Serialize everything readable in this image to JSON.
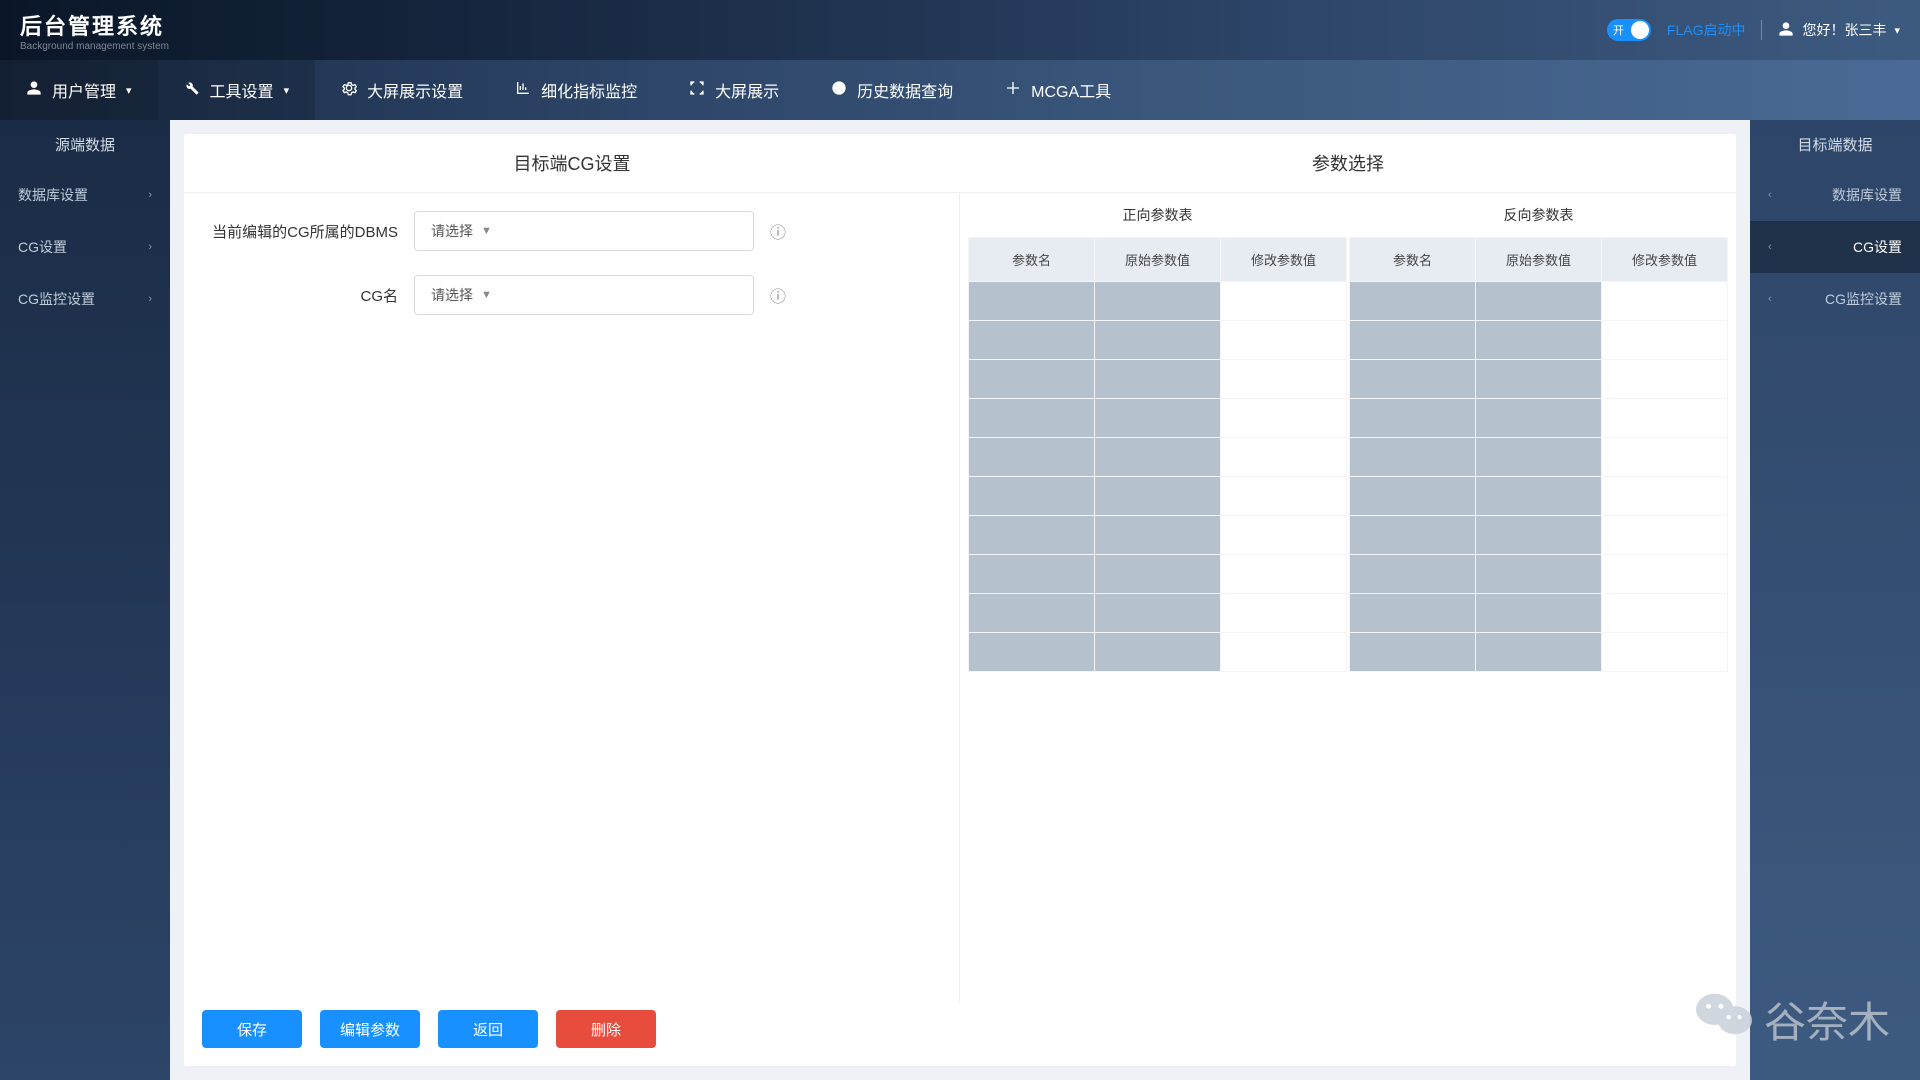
{
  "header": {
    "title": "后台管理系统",
    "subtitle": "Background management system",
    "toggle_on": "开",
    "flag_label": "FLAG启动中",
    "user_greeting": "您好！张三丰"
  },
  "topnav": [
    {
      "label": "用户管理",
      "has_caret": true
    },
    {
      "label": "工具设置",
      "has_caret": true
    },
    {
      "label": "大屏展示设置",
      "has_caret": false
    },
    {
      "label": "细化指标监控",
      "has_caret": false
    },
    {
      "label": "大屏展示",
      "has_caret": false
    },
    {
      "label": "历史数据查询",
      "has_caret": false
    },
    {
      "label": "MCGA工具",
      "has_caret": false
    }
  ],
  "left_sidebar": {
    "title": "源端数据",
    "items": [
      {
        "label": "数据库设置"
      },
      {
        "label": "CG设置"
      },
      {
        "label": "CG监控设置"
      }
    ]
  },
  "right_sidebar": {
    "title": "目标端数据",
    "items": [
      {
        "label": "数据库设置"
      },
      {
        "label": "CG设置"
      },
      {
        "label": "CG监控设置"
      }
    ]
  },
  "left_panel": {
    "title": "目标端CG设置",
    "form": {
      "dbms_label": "当前编辑的CG所属的DBMS",
      "cg_label": "CG名",
      "placeholder": "请选择"
    }
  },
  "right_panel": {
    "title": "参数选择",
    "tables": {
      "forward_caption": "正向参数表",
      "reverse_caption": "反向参数表",
      "headers": {
        "name": "参数名",
        "orig": "原始参数值",
        "mod": "修改参数值"
      },
      "row_count": 10
    }
  },
  "buttons": {
    "save": "保存",
    "edit_params": "编辑参数",
    "back": "返回",
    "delete": "删除"
  },
  "watermark": "谷奈木"
}
